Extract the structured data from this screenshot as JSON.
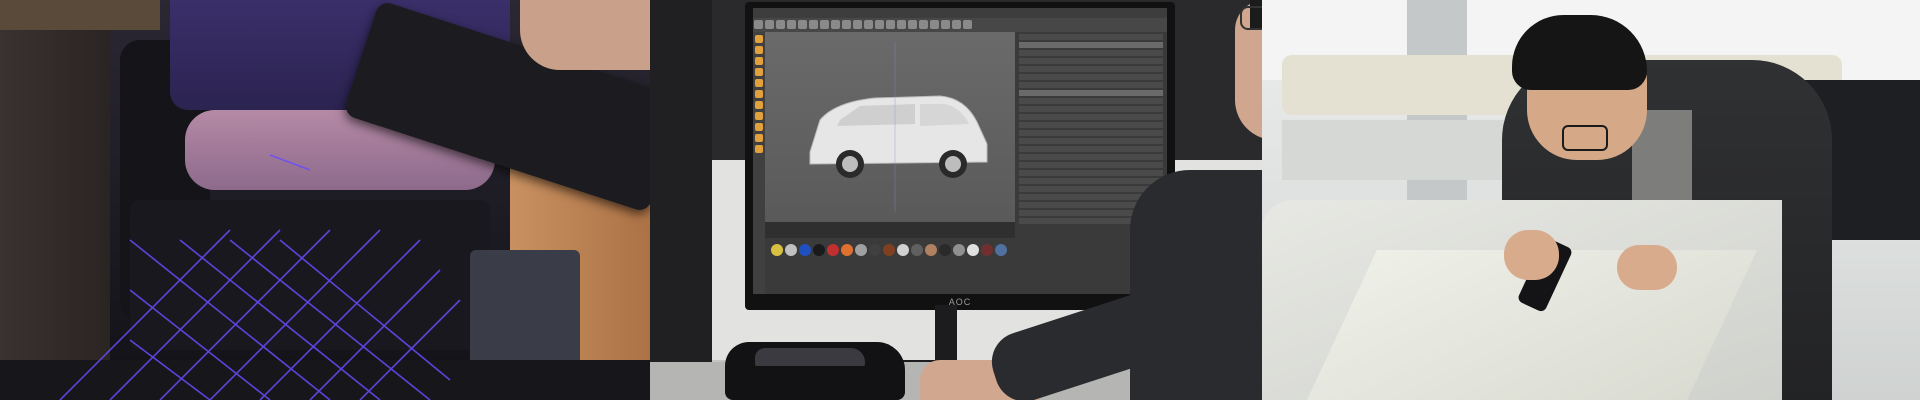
{
  "banner": {
    "panels": [
      {
        "subject": "seat-laser-scanning"
      },
      {
        "subject": "vehicle-3d-modeling-workstation"
      },
      {
        "subject": "engineer-scanning-model"
      }
    ]
  },
  "monitor": {
    "brand": "AOC"
  },
  "colors": {
    "laser": "#6a4cff",
    "screen_bg": "#585858",
    "ui_accent": "#e2a13c",
    "model_surface": "#e7e8e3"
  },
  "material_swatches": [
    "#d8c040",
    "#c0c0c0",
    "#2050c0",
    "#1a1a1a",
    "#c03030",
    "#e07030",
    "#a0a0a0",
    "#404040",
    "#804020",
    "#d0d0d0",
    "#606060",
    "#b08060",
    "#2a2a2a",
    "#909090",
    "#e0e0e0",
    "#703030",
    "#5070a0"
  ]
}
